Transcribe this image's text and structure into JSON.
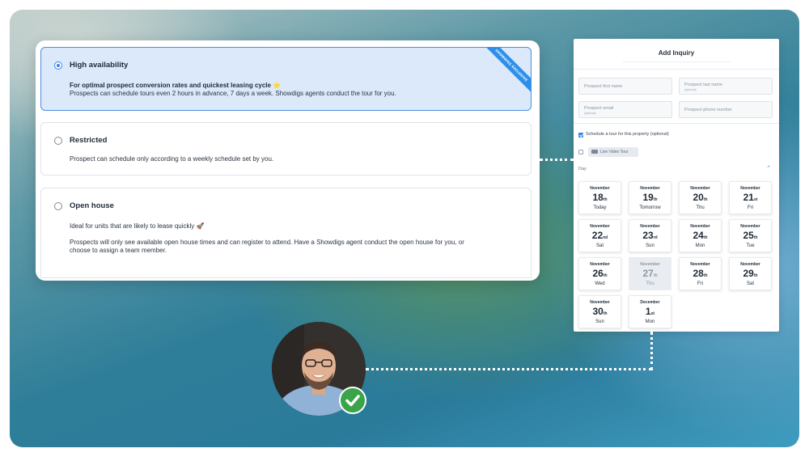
{
  "options": [
    {
      "title": "High availability",
      "lines": [
        "For optimal prospect conversion rates and quickest leasing cycle ⭐",
        "Prospects can schedule tours even 2 hours in advance, 7 days a week. Showdigs agents conduct the tour for you."
      ],
      "selected": true,
      "ribbon": "SHOWDIGS EXCLUSIVE"
    },
    {
      "title": "Restricted",
      "lines": [
        "Prospect can schedule only according to a weekly schedule set by you."
      ],
      "selected": false
    },
    {
      "title": "Open house",
      "lines": [
        "Ideal for units that are likely to lease quickly 🚀",
        "Prospects will only see available open house times and can register to attend. Have a Showdigs agent conduct the open house for you, or",
        "choose to assign a team member."
      ],
      "selected": false
    }
  ],
  "inquiry": {
    "title": "Add Inquiry",
    "fields": {
      "first_name": "Prospect first name",
      "last_name": "Prospect last name",
      "last_name_sub": "(optional)",
      "email": "Prospect email",
      "email_sub": "(optional)",
      "phone": "Prospect phone number"
    },
    "schedule_label": "Schedule a tour for this property (optional)",
    "schedule_checked": true,
    "video_checked": false,
    "video_label": "Live Video Tour",
    "day_label": "Day",
    "days": [
      {
        "month": "November",
        "date": "18",
        "suffix": "th",
        "dow": "Today",
        "disabled": false
      },
      {
        "month": "November",
        "date": "19",
        "suffix": "th",
        "dow": "Tomorrow",
        "disabled": false
      },
      {
        "month": "November",
        "date": "20",
        "suffix": "th",
        "dow": "Thu",
        "disabled": false
      },
      {
        "month": "November",
        "date": "21",
        "suffix": "st",
        "dow": "Fri",
        "disabled": false
      },
      {
        "month": "November",
        "date": "22",
        "suffix": "nd",
        "dow": "Sat",
        "disabled": false
      },
      {
        "month": "November",
        "date": "23",
        "suffix": "rd",
        "dow": "Sun",
        "disabled": false
      },
      {
        "month": "November",
        "date": "24",
        "suffix": "th",
        "dow": "Mon",
        "disabled": false
      },
      {
        "month": "November",
        "date": "25",
        "suffix": "th",
        "dow": "Tue",
        "disabled": false
      },
      {
        "month": "November",
        "date": "26",
        "suffix": "th",
        "dow": "Wed",
        "disabled": false
      },
      {
        "month": "November",
        "date": "27",
        "suffix": "th",
        "dow": "Thu",
        "disabled": true
      },
      {
        "month": "November",
        "date": "28",
        "suffix": "th",
        "dow": "Fri",
        "disabled": false
      },
      {
        "month": "November",
        "date": "29",
        "suffix": "th",
        "dow": "Sat",
        "disabled": false
      },
      {
        "month": "November",
        "date": "30",
        "suffix": "th",
        "dow": "Sun",
        "disabled": false
      },
      {
        "month": "December",
        "date": "1",
        "suffix": "st",
        "dow": "Mon",
        "disabled": false
      }
    ]
  },
  "colors": {
    "accent": "#3b82e6",
    "selected_bg": "#dbe9fb",
    "check_green": "#3aa44a"
  },
  "icons": {
    "avatar": "person-photo",
    "badge": "checkmark-icon",
    "radio": "radio-icon",
    "video": "video-camera-icon",
    "caret": "chevron-up-icon"
  }
}
